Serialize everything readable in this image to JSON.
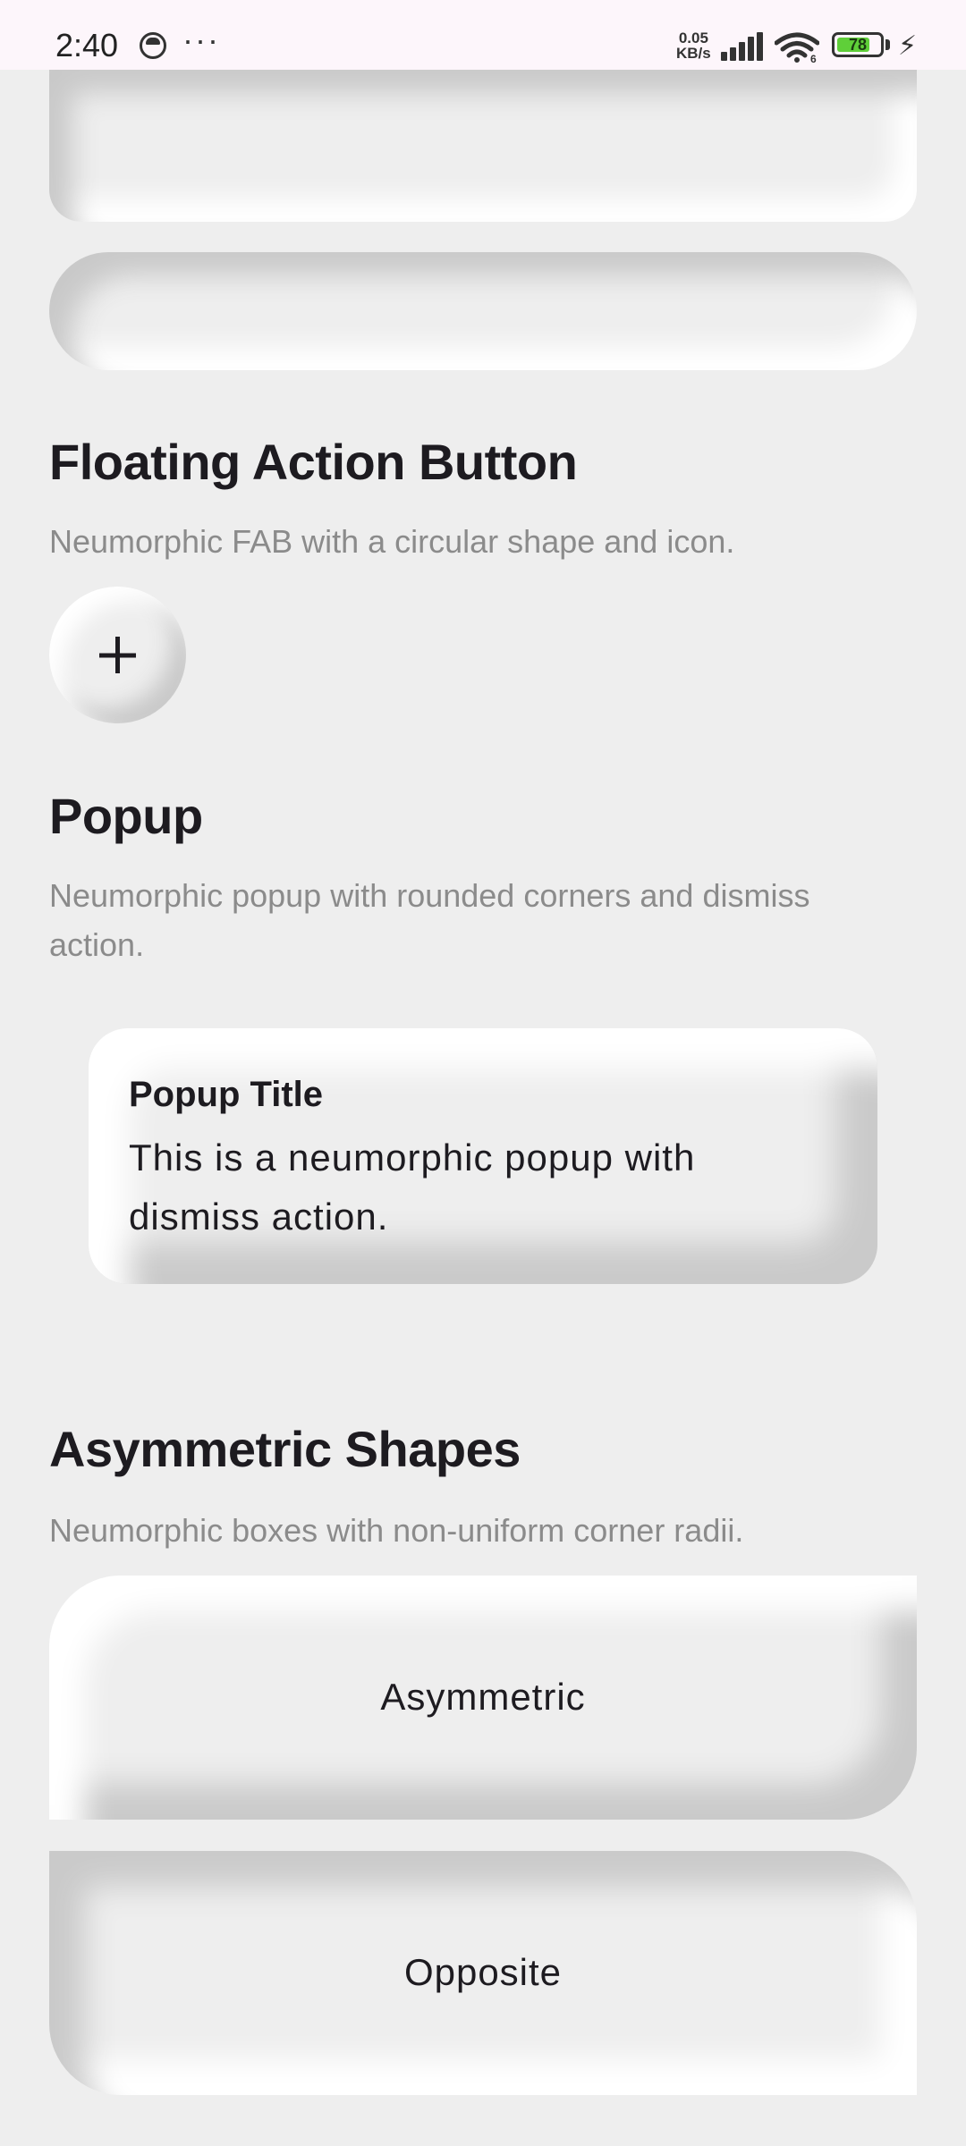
{
  "status_bar": {
    "time": "2:40",
    "more": "···",
    "net_speed_top": "0.05",
    "net_speed_bottom": "KB/s",
    "wifi_label": "6",
    "battery": "78"
  },
  "sections": {
    "fab": {
      "title": "Floating Action Button",
      "description": "Neumorphic FAB with a circular shape and icon.",
      "icon": "plus-icon"
    },
    "popup": {
      "title": "Popup",
      "description": "Neumorphic popup with rounded corners and dismiss action.",
      "popup_title": "Popup Title",
      "popup_body": "This is a neumorphic popup with dismiss action."
    },
    "asymmetric": {
      "title": "Asymmetric Shapes",
      "description": "Neumorphic boxes with non-uniform corner radii.",
      "box1_label": "Asymmetric",
      "box2_label": "Opposite"
    }
  },
  "colors": {
    "background": "#eeeeee",
    "shadow_dark": "#c9c9c9",
    "shadow_light": "#ffffff",
    "status_bar_bg": "#fdf6fb",
    "battery_fill": "#5fcf39"
  }
}
